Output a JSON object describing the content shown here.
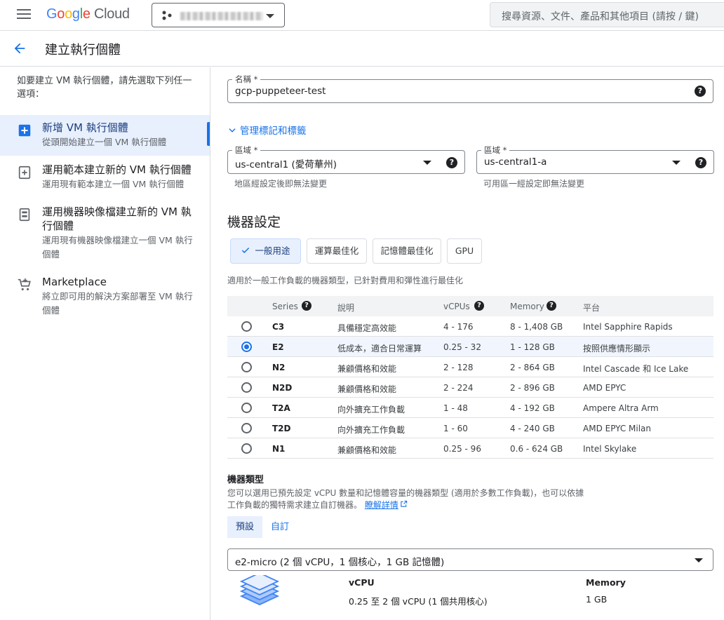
{
  "topbar": {
    "logo_google": "Google",
    "logo_cloud": "Cloud",
    "search_placeholder": "搜尋資源、文件、產品和其他項目 (請按 / 鍵)"
  },
  "page": {
    "title": "建立執行個體"
  },
  "sidebar": {
    "intro": "如要建立 VM 執行個體，請先選取下列任一選項：",
    "items": [
      {
        "title": "新增 VM 執行個體",
        "subtitle": "從頭開始建立一個 VM 執行個體",
        "icon": "add-box-icon",
        "active": true
      },
      {
        "title": "運用範本建立新的 VM 執行個體",
        "subtitle": "運用現有範本建立一個 VM 執行個體",
        "icon": "template-add-icon",
        "active": false
      },
      {
        "title": "運用機器映像檔建立新的 VM 執行個體",
        "subtitle": "運用現有機器映像檔建立一個 VM 執行個體",
        "icon": "machine-image-icon",
        "active": false
      },
      {
        "title": "Marketplace",
        "subtitle": "將立即可用的解決方案部署至 VM 執行個體",
        "icon": "cart-icon",
        "active": false
      }
    ]
  },
  "form": {
    "name_label": "名稱 *",
    "name_value": "gcp-puppeteer-test",
    "manage_labels_link": "管理標記和標籤",
    "region_label": "區域 *",
    "region_value": "us-central1 (愛荷華州)",
    "region_hint": "地區經設定後即無法變更",
    "zone_label": "區域 *",
    "zone_value": "us-central1-a",
    "zone_hint": "可用區一經設定即無法變更"
  },
  "machine": {
    "section_title": "機器設定",
    "families": [
      "一般用途",
      "運算最佳化",
      "記憶體最佳化",
      "GPU"
    ],
    "selected_family": "一般用途",
    "family_desc": "適用於一般工作負載的機器類型，已針對費用和彈性進行最佳化",
    "table_headers": [
      "Series",
      "說明",
      "vCPUs",
      "Memory",
      "平台"
    ],
    "rows": [
      {
        "series": "C3",
        "desc": "具備穩定高效能",
        "vcpus": "4 - 176",
        "memory": "8 - 1,408 GB",
        "platform": "Intel Sapphire Rapids",
        "selected": false
      },
      {
        "series": "E2",
        "desc": "低成本，適合日常運算",
        "vcpus": "0.25 - 32",
        "memory": "1 - 128 GB",
        "platform": "按照供應情形顯示",
        "selected": true
      },
      {
        "series": "N2",
        "desc": "兼顧價格和效能",
        "vcpus": "2 - 128",
        "memory": "2 - 864 GB",
        "platform": "Intel Cascade 和 Ice Lake",
        "selected": false
      },
      {
        "series": "N2D",
        "desc": "兼顧價格和效能",
        "vcpus": "2 - 224",
        "memory": "2 - 896 GB",
        "platform": "AMD EPYC",
        "selected": false
      },
      {
        "series": "T2A",
        "desc": "向外擴充工作負載",
        "vcpus": "1 - 48",
        "memory": "4 - 192 GB",
        "platform": "Ampere Altra Arm",
        "selected": false
      },
      {
        "series": "T2D",
        "desc": "向外擴充工作負載",
        "vcpus": "1 - 60",
        "memory": "4 - 240 GB",
        "platform": "AMD EPYC Milan",
        "selected": false
      },
      {
        "series": "N1",
        "desc": "兼顧價格和效能",
        "vcpus": "0.25 - 96",
        "memory": "0.6 - 624 GB",
        "platform": "Intel Skylake",
        "selected": false
      }
    ],
    "machine_type_title": "機器類型",
    "machine_type_desc_1": "您可以選用已預先設定 vCPU 數量和記憶體容量的機器類型 (適用於多數工作負載)，也可以依據",
    "machine_type_desc_2": "工作負載的獨特需求建立自訂機器。",
    "learn_more": "瞭解詳情",
    "tabs": [
      "預設",
      "自訂"
    ],
    "machine_type_value": "e2-micro (2 個 vCPU，1 個核心，1 GB 記憶體)",
    "vcpu_label": "vCPU",
    "vcpu_value": "0.25 至 2 個 vCPU (1 個共用核心)",
    "memory_label": "Memory",
    "memory_value": "1 GB"
  },
  "colors": {
    "accent": "#1a73e8",
    "selected_bg": "#e8f0fe"
  }
}
